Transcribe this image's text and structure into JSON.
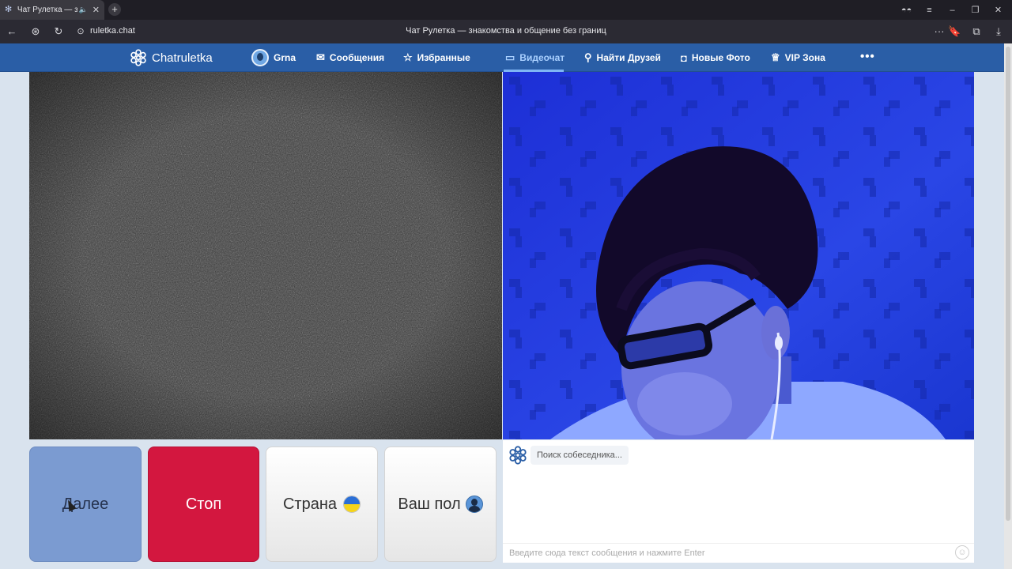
{
  "browser": {
    "tab_title": "Чат Рулетка — знак",
    "url": "ruletka.chat",
    "page_title": "Чат Рулетка — знакомства и общение без границ"
  },
  "nav": {
    "brand": "Chatruletka",
    "profile": "Grna",
    "messages": "Сообщения",
    "favorites": "Избранные",
    "videochat": "Видеочат",
    "find_friends": "Найти Друзей",
    "new_photos": "Новые Фото",
    "vip": "VIP Зона"
  },
  "controls": {
    "next": "Далее",
    "stop": "Стоп",
    "country": "Страна",
    "gender": "Ваш пол"
  },
  "chat": {
    "status": "Поиск собеседника...",
    "input_placeholder": "Введите сюда текст сообщения и нажмите Enter"
  },
  "colors": {
    "nav_bg": "#2a5ea6",
    "next_bg": "#7b9bd1",
    "stop_bg": "#d3173f",
    "video_right_bg": "#1a3dc9"
  }
}
